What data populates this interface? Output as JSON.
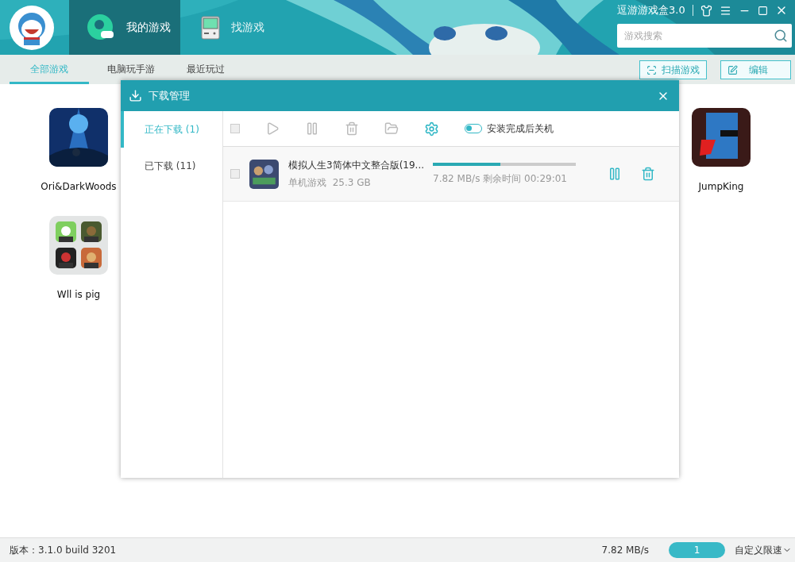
{
  "app": {
    "title": "逗游游戏盒3.0"
  },
  "main_tabs": [
    {
      "label": "我的游戏",
      "selected": true
    },
    {
      "label": "找游戏",
      "selected": false
    }
  ],
  "search": {
    "placeholder": "游戏搜索"
  },
  "sub_tabs": [
    {
      "label": "全部游戏",
      "selected": true
    },
    {
      "label": "电脑玩手游",
      "selected": false
    },
    {
      "label": "最近玩过",
      "selected": false
    }
  ],
  "actions": [
    {
      "label": "扫描游戏",
      "kind": "scan"
    },
    {
      "label": "编辑",
      "kind": "edit"
    }
  ],
  "game_rows": [
    [
      {
        "name": "Ori&DarkWoods",
        "kind": "single"
      },
      {
        "name": "JumpKing",
        "kind": "single"
      }
    ],
    [
      {
        "name": "Wll is pig",
        "kind": "folder"
      }
    ]
  ],
  "dialog": {
    "title": "下载管理",
    "side_items": [
      {
        "label": "正在下载 (1)",
        "selected": true
      },
      {
        "label": "已下载 (11)",
        "selected": false
      }
    ],
    "toolbar": {
      "select_all": false,
      "shutdown_label": "安装完成后关机",
      "shutdown_on": false
    },
    "downloads": [
      {
        "name": "模拟人生3简体中文整合版(19...",
        "category": "单机游戏",
        "size": "25.3 GB",
        "level": 0.47,
        "speed": "7.82 MB/s",
        "remaining": "剩余时间 00:29:01",
        "checked": false
      }
    ]
  },
  "status_bar": {
    "version": "版本：3.1.0 build 3201",
    "speed": "7.82 MB/s",
    "badge": "1",
    "limit": "自定义限速"
  }
}
